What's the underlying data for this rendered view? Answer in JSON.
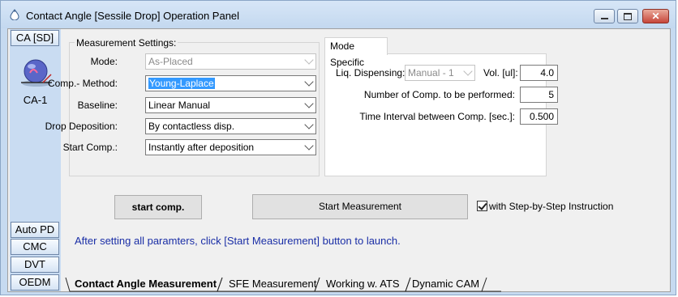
{
  "window": {
    "title": "Contact Angle [Sessile Drop] Operation Panel",
    "minimize_icon": "minimize-icon",
    "maximize_icon": "maximize-icon",
    "close_icon": "close-icon"
  },
  "sidebar": {
    "top_button": "CA [SD]",
    "app_label": "CA-1",
    "bottom_buttons": [
      "Auto PD",
      "CMC",
      "DVT",
      "OEDM"
    ]
  },
  "measurement_settings": {
    "group_label": "Measurement Settings:",
    "mode": {
      "label": "Mode:",
      "value": "As-Placed"
    },
    "comp_method": {
      "label": "Comp.- Method:",
      "value": "Young-Laplace"
    },
    "baseline": {
      "label": "Baseline:",
      "value": "Linear Manual"
    },
    "drop_deposition": {
      "label": "Drop Deposition:",
      "value": "By contactless disp."
    },
    "start_comp": {
      "label": "Start Comp.:",
      "value": "Instantly after deposition"
    }
  },
  "mode_specific": {
    "tab_label": "Mode Specific",
    "liq_dispensing": {
      "label": "Liq. Dispensing:",
      "value": "Manual - 1"
    },
    "volume": {
      "label": "Vol. [ul]:",
      "value": "4.0"
    },
    "num_comp": {
      "label": "Number of Comp. to be performed:",
      "value": "5"
    },
    "time_interval": {
      "label": "Time Interval between Comp. [sec.]:",
      "value": "0.500"
    }
  },
  "actions": {
    "start_comp": "start comp.",
    "start_measurement": "Start Measurement",
    "step_by_step": "with Step-by-Step Instruction",
    "step_by_step_checked": true
  },
  "info_text": "After setting all paramters, click [Start Measurement] button to launch.",
  "tabs": [
    "Contact Angle Measurement",
    "SFE Measurement",
    "Working w. ATS",
    "Dynamic CAM"
  ]
}
